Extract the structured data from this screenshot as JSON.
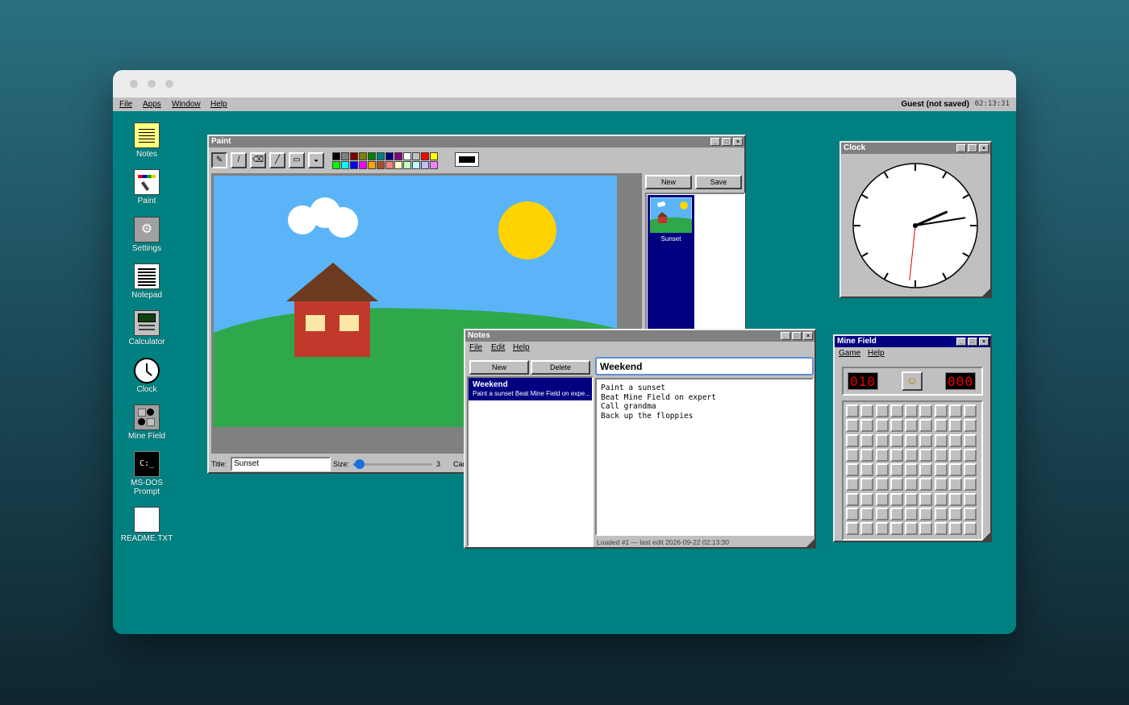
{
  "menubar": {
    "items": [
      "File",
      "Apps",
      "Window",
      "Help"
    ],
    "user": "Guest (not saved)",
    "time": "02:13:31"
  },
  "desktop_icons": [
    {
      "label": "Notes",
      "icon": "notes-icon"
    },
    {
      "label": "Paint",
      "icon": "paint-icon"
    },
    {
      "label": "Settings",
      "icon": "settings-icon"
    },
    {
      "label": "Notepad",
      "icon": "notepad-icon"
    },
    {
      "label": "Calculator",
      "icon": "calculator-icon"
    },
    {
      "label": "Clock",
      "icon": "clock-icon"
    },
    {
      "label": "Mine Field",
      "icon": "minefield-icon"
    },
    {
      "label": "MS-DOS Prompt",
      "icon": "msdos-icon"
    },
    {
      "label": "README.TXT",
      "icon": "readme-icon"
    }
  ],
  "paint": {
    "title": "Paint",
    "tools": [
      "pencil-icon",
      "brush-icon",
      "eraser-icon",
      "line-icon",
      "rectangle-icon",
      "fill-icon"
    ],
    "palette": [
      "#000000",
      "#808080",
      "#800000",
      "#808000",
      "#008000",
      "#008080",
      "#000080",
      "#800080",
      "#ffffff",
      "#c0c0c0",
      "#ff0000",
      "#ffff00",
      "#00ff00",
      "#00ffff",
      "#0000ff",
      "#ff00ff",
      "#ffa500",
      "#a0522d",
      "#ff8080",
      "#ffffc0",
      "#c0ffc0",
      "#c0ffff",
      "#c0c0ff",
      "#ff80ff"
    ],
    "current_color": "#000000",
    "new_label": "New",
    "save_label": "Save",
    "gallery": [
      {
        "name": "Sunset"
      }
    ],
    "title_label": "Title:",
    "title_value": "Sunset",
    "size_label": "Size:",
    "size_value": "3",
    "size_fraction": 0.08,
    "cancel_label": "Can"
  },
  "notes": {
    "title": "Notes",
    "menu": [
      "File",
      "Edit",
      "Help"
    ],
    "new_label": "New",
    "delete_label": "Delete",
    "list": [
      {
        "title": "Weekend",
        "preview": "Paint a sunset Beat Mine Field on expe..."
      }
    ],
    "note_title": "Weekend",
    "body_lines": [
      "Paint a sunset",
      "Beat Mine Field on expert",
      "Call grandma",
      "Back up the floppies"
    ],
    "status": "Loaded #1 — last edit 2026-09-22 02:13:30"
  },
  "clock": {
    "title": "Clock",
    "hours": 2,
    "minutes": 13,
    "seconds": 31
  },
  "minefield": {
    "title": "Mine Field",
    "menu": [
      "Game",
      "Help"
    ],
    "mines_left": "010",
    "timer": "000",
    "face": "☺",
    "rows": 9,
    "cols": 9
  },
  "colors": {
    "desktop": "#008080",
    "active_title": "#000080",
    "inactive_title": "#808080"
  }
}
